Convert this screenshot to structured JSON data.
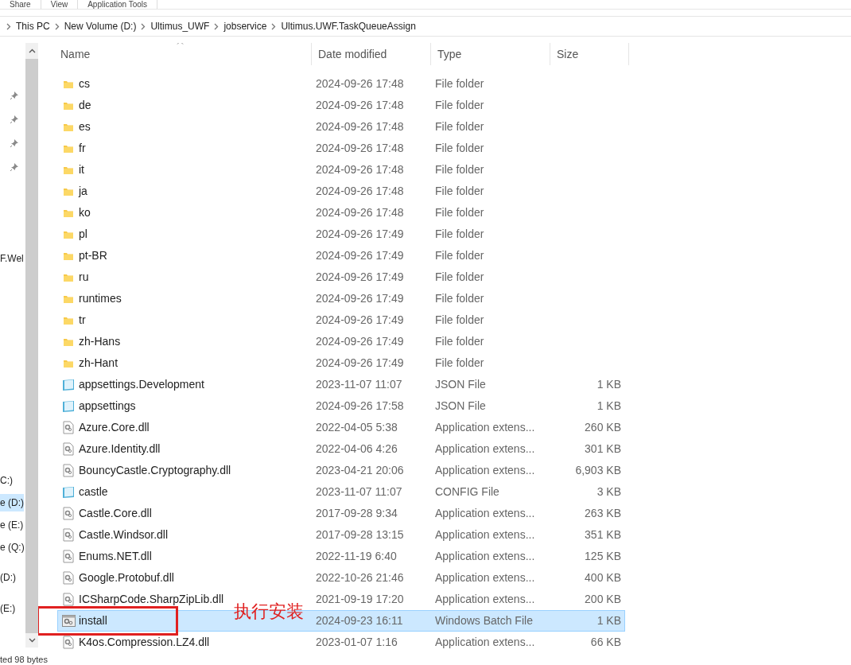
{
  "ribbon_tabs": [
    {
      "label": "Share"
    },
    {
      "label": "View"
    },
    {
      "label": "Application Tools"
    }
  ],
  "breadcrumb": [
    "This PC",
    "New Volume (D:)",
    "Ultimus_UWF",
    "jobservice",
    "Ultimus.UWF.TaskQueueAssign"
  ],
  "sidebar": {
    "items": [
      {
        "kind": "pin"
      },
      {
        "kind": "pin"
      },
      {
        "kind": "pin"
      },
      {
        "kind": "pin"
      },
      {
        "label": "F.Wel",
        "kind": "text",
        "selected": false
      },
      {
        "label": "C:)",
        "kind": "text",
        "selected": false
      },
      {
        "label": "e (D:)",
        "kind": "text",
        "selected": true
      },
      {
        "label": "e (E:)",
        "kind": "text",
        "selected": false
      },
      {
        "label": "e (Q:)",
        "kind": "text",
        "selected": false
      },
      {
        "label": "(D:)",
        "kind": "text",
        "selected": false
      },
      {
        "label": "(E:)",
        "kind": "text",
        "selected": false
      }
    ]
  },
  "table": {
    "columns": [
      "Name",
      "Date modified",
      "Type",
      "Size"
    ],
    "rows": [
      {
        "kind": "folder",
        "name": "cs",
        "date": "2024-09-26 17:48",
        "type": "File folder",
        "size": "",
        "selected": false
      },
      {
        "kind": "folder",
        "name": "de",
        "date": "2024-09-26 17:48",
        "type": "File folder",
        "size": "",
        "selected": false
      },
      {
        "kind": "folder",
        "name": "es",
        "date": "2024-09-26 17:48",
        "type": "File folder",
        "size": "",
        "selected": false
      },
      {
        "kind": "folder",
        "name": "fr",
        "date": "2024-09-26 17:48",
        "type": "File folder",
        "size": "",
        "selected": false
      },
      {
        "kind": "folder",
        "name": "it",
        "date": "2024-09-26 17:48",
        "type": "File folder",
        "size": "",
        "selected": false
      },
      {
        "kind": "folder",
        "name": "ja",
        "date": "2024-09-26 17:48",
        "type": "File folder",
        "size": "",
        "selected": false
      },
      {
        "kind": "folder",
        "name": "ko",
        "date": "2024-09-26 17:48",
        "type": "File folder",
        "size": "",
        "selected": false
      },
      {
        "kind": "folder",
        "name": "pl",
        "date": "2024-09-26 17:49",
        "type": "File folder",
        "size": "",
        "selected": false
      },
      {
        "kind": "folder",
        "name": "pt-BR",
        "date": "2024-09-26 17:49",
        "type": "File folder",
        "size": "",
        "selected": false
      },
      {
        "kind": "folder",
        "name": "ru",
        "date": "2024-09-26 17:49",
        "type": "File folder",
        "size": "",
        "selected": false
      },
      {
        "kind": "folder",
        "name": "runtimes",
        "date": "2024-09-26 17:49",
        "type": "File folder",
        "size": "",
        "selected": false
      },
      {
        "kind": "folder",
        "name": "tr",
        "date": "2024-09-26 17:49",
        "type": "File folder",
        "size": "",
        "selected": false
      },
      {
        "kind": "folder",
        "name": "zh-Hans",
        "date": "2024-09-26 17:49",
        "type": "File folder",
        "size": "",
        "selected": false
      },
      {
        "kind": "folder",
        "name": "zh-Hant",
        "date": "2024-09-26 17:49",
        "type": "File folder",
        "size": "",
        "selected": false
      },
      {
        "kind": "settings",
        "name": "appsettings.Development",
        "date": "2023-11-07 11:07",
        "type": "JSON File",
        "size": "1 KB",
        "selected": false
      },
      {
        "kind": "settings",
        "name": "appsettings",
        "date": "2024-09-26 17:58",
        "type": "JSON File",
        "size": "1 KB",
        "selected": false
      },
      {
        "kind": "dll",
        "name": "Azure.Core.dll",
        "date": "2022-04-05 5:38",
        "type": "Application extens...",
        "size": "260 KB",
        "selected": false
      },
      {
        "kind": "dll",
        "name": "Azure.Identity.dll",
        "date": "2022-04-06 4:26",
        "type": "Application extens...",
        "size": "301 KB",
        "selected": false
      },
      {
        "kind": "dll",
        "name": "BouncyCastle.Cryptography.dll",
        "date": "2023-04-21 20:06",
        "type": "Application extens...",
        "size": "6,903 KB",
        "selected": false
      },
      {
        "kind": "settings",
        "name": "castle",
        "date": "2023-11-07 11:07",
        "type": "CONFIG File",
        "size": "3 KB",
        "selected": false
      },
      {
        "kind": "dll",
        "name": "Castle.Core.dll",
        "date": "2017-09-28 9:34",
        "type": "Application extens...",
        "size": "263 KB",
        "selected": false
      },
      {
        "kind": "dll",
        "name": "Castle.Windsor.dll",
        "date": "2017-09-28 13:15",
        "type": "Application extens...",
        "size": "351 KB",
        "selected": false
      },
      {
        "kind": "dll",
        "name": "Enums.NET.dll",
        "date": "2022-11-19 6:40",
        "type": "Application extens...",
        "size": "125 KB",
        "selected": false
      },
      {
        "kind": "dll",
        "name": "Google.Protobuf.dll",
        "date": "2022-10-26 21:46",
        "type": "Application extens...",
        "size": "400 KB",
        "selected": false
      },
      {
        "kind": "dll",
        "name": "ICSharpCode.SharpZipLib.dll",
        "date": "2021-09-19 17:20",
        "type": "Application extens...",
        "size": "200 KB",
        "selected": false
      },
      {
        "kind": "batch",
        "name": "install",
        "date": "2024-09-23 16:11",
        "type": "Windows Batch File",
        "size": "1 KB",
        "selected": true,
        "annotation": "执行安装"
      },
      {
        "kind": "dll",
        "name": "K4os.Compression.LZ4.dll",
        "date": "2023-01-07 1:16",
        "type": "Application extens...",
        "size": "66 KB",
        "selected": false
      }
    ]
  },
  "status_bar": "ted  98 bytes"
}
